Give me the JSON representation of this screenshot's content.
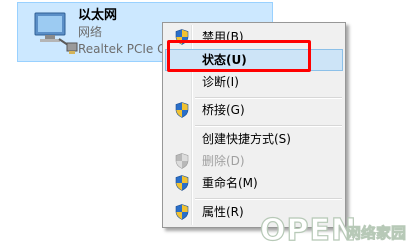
{
  "adapter": {
    "name": "以太网",
    "status": "网络",
    "device": "Realtek PCIe GBE Family Controller"
  },
  "context_menu": {
    "items": [
      {
        "label": "禁用(B)",
        "icon": "shield-icon",
        "state": "normal"
      },
      {
        "label": "状态(U)",
        "icon": "",
        "state": "highlighted"
      },
      {
        "label": "诊断(I)",
        "icon": "",
        "state": "normal"
      },
      {
        "label": "桥接(G)",
        "icon": "shield-icon",
        "state": "normal"
      },
      {
        "label": "创建快捷方式(S)",
        "icon": "",
        "state": "normal"
      },
      {
        "label": "删除(D)",
        "icon": "shield-icon",
        "state": "disabled"
      },
      {
        "label": "重命名(M)",
        "icon": "shield-icon",
        "state": "normal"
      },
      {
        "label": "属性(R)",
        "icon": "shield-icon",
        "state": "normal"
      }
    ]
  },
  "watermark": {
    "brand": "OPEN",
    "subtitle": "网络家园"
  },
  "colors": {
    "selection_bg": "#cce8ff",
    "menu_bg": "#f0f0f0",
    "highlight_border": "#ff0000",
    "watermark": "#c9d6c9"
  }
}
